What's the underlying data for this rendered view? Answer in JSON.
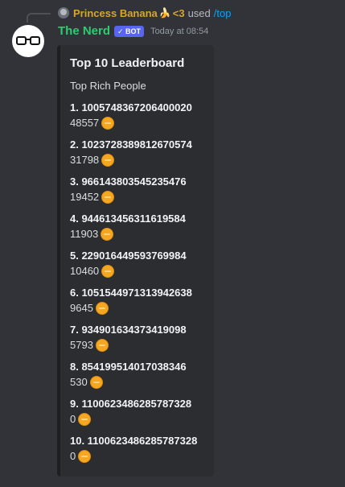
{
  "reply": {
    "user": "Princess Banana",
    "emoji": "🍌",
    "heart": "<3",
    "used_text": "used",
    "command": "/top"
  },
  "message": {
    "username": "The Nerd",
    "bot_badge": "✓ BOT",
    "timestamp": "Today at 08:54"
  },
  "embed": {
    "title": "Top 10 Leaderboard",
    "description": "Top Rich People",
    "entries": [
      {
        "label": "1. 1005748367206400020",
        "amount": "48557"
      },
      {
        "label": "2. 1023728389812670574",
        "amount": "31798"
      },
      {
        "label": "3. 966143803545235476",
        "amount": "19452"
      },
      {
        "label": "4. 944613456311619584",
        "amount": "11903"
      },
      {
        "label": "5. 229016449593769984",
        "amount": "10460"
      },
      {
        "label": "6. 1051544971313942638",
        "amount": "9645"
      },
      {
        "label": "7. 934901634373419098",
        "amount": "5793"
      },
      {
        "label": "8. 854199514017038346",
        "amount": "530"
      },
      {
        "label": "9. 1100623486285787328",
        "amount": "0"
      },
      {
        "label": "10. 1100623486285787328",
        "amount": "0"
      }
    ]
  },
  "colors": {
    "background": "#313338",
    "embed_background": "#2b2d31",
    "username": "#2ecc71",
    "reply_name": "#d7a62b",
    "command": "#00a8fc",
    "bot_badge": "#5865f2",
    "coin": "#f5a623"
  },
  "icons": {
    "reply_avatar": "user-avatar-icon",
    "avatar": "nerd-glasses-avatar",
    "coin": "coin-icon"
  }
}
